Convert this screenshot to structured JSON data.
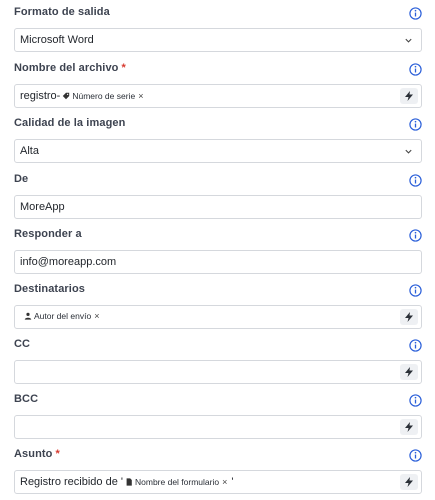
{
  "fields": {
    "formato": {
      "label": "Formato de salida",
      "value": "Microsoft Word"
    },
    "nombre": {
      "label": "Nombre del archivo",
      "required": "*",
      "prefix": "registro-",
      "chip": "Número de serie",
      "remove": "×"
    },
    "calidad": {
      "label": "Calidad de la imagen",
      "value": "Alta"
    },
    "de": {
      "label": "De",
      "value": "MoreApp"
    },
    "responder": {
      "label": "Responder a",
      "value": "info@moreapp.com"
    },
    "destinatarios": {
      "label": "Destinatarios",
      "chip": "Autor del envío",
      "remove": "×"
    },
    "cc": {
      "label": "CC"
    },
    "bcc": {
      "label": "BCC"
    },
    "asunto": {
      "label": "Asunto",
      "required": "*",
      "prefix": "Registro recibido de '",
      "chip": "Nombre del formulario",
      "remove": "×",
      "suffix": "'"
    }
  },
  "icons": {
    "info": "info-circle-icon",
    "chevron": "chevron-down-icon",
    "bolt": "lightning-bolt-icon",
    "tag": "tag-icon",
    "user": "user-icon",
    "document": "document-icon"
  },
  "colors": {
    "required": "#d73a2f",
    "info": "#2b5fd9",
    "border": "#d5d8dd",
    "bolt_bg": "#eef0f3"
  }
}
